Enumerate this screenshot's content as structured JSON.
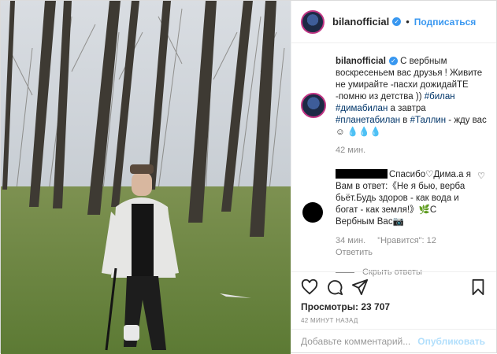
{
  "header": {
    "username": "bilanofficial",
    "separator": "•",
    "follow_label": "Подписаться"
  },
  "caption": {
    "username": "bilanofficial",
    "text_1": " С вербным воскресеньем вас друзья ! Живите не умирайте -пасхи дожидайТЕ -помню из детства )) ",
    "tag_1": "#билан",
    "tag_2": "#димабилан",
    "text_2": " а завтра ",
    "tag_3": "#планетабилан",
    "text_3": " в ",
    "tag_4": "#Таллин",
    "text_4": " - жду вас ☺ 💧💧💧",
    "time": "42 мин."
  },
  "reply": {
    "text": "Спасибо♡Дима.а я Вам в ответ:《Не я бью, верба бьёт.Будь здоров - как вода и богат - как земля!》🌿С Вербным Вас📷",
    "time": "34 мин.",
    "likes": "\"Нравится\": 12",
    "reply_label": "Ответить"
  },
  "hide_replies_label": "Скрыть ответы",
  "stats": {
    "views": "Просмотры: 23 707",
    "ago": "42 МИНУТ НАЗАД"
  },
  "comment_box": {
    "placeholder": "Добавьте комментарий...",
    "publish_label": "Опубликовать"
  },
  "icons": [
    "heart-icon",
    "comment-icon",
    "share-icon",
    "bookmark-icon",
    "verified-icon"
  ],
  "colors": {
    "link": "#3897f0",
    "hashtag": "#003569",
    "muted": "#8e8e8e"
  }
}
